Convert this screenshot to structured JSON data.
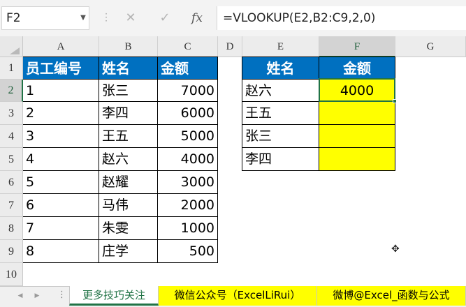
{
  "formula_bar": {
    "name_box": "F2",
    "cancel_icon": "✕",
    "enter_icon": "✓",
    "fx_label": "fx",
    "formula": "=VLOOKUP(E2,B2:C9,2,0)"
  },
  "columns": [
    "A",
    "B",
    "C",
    "D",
    "E",
    "F",
    "G"
  ],
  "rows": [
    "1",
    "2",
    "3",
    "4",
    "5",
    "6",
    "7",
    "8",
    "9",
    "10"
  ],
  "table1": {
    "headers": [
      "员工编号",
      "姓名",
      "金额"
    ],
    "rows": [
      [
        "1",
        "张三",
        "7000"
      ],
      [
        "2",
        "李四",
        "6000"
      ],
      [
        "3",
        "王五",
        "5000"
      ],
      [
        "4",
        "赵六",
        "4000"
      ],
      [
        "5",
        "赵耀",
        "3000"
      ],
      [
        "6",
        "马伟",
        "2000"
      ],
      [
        "7",
        "朱雯",
        "1000"
      ],
      [
        "8",
        "庄学",
        "500"
      ]
    ]
  },
  "table2": {
    "headers": [
      "姓名",
      "金额"
    ],
    "rows": [
      [
        "赵六",
        "4000"
      ],
      [
        "王五",
        ""
      ],
      [
        "张三",
        ""
      ],
      [
        "李四",
        ""
      ]
    ]
  },
  "sheet_tabs": [
    "更多技巧关注",
    "微信公众号（ExcelLiRui）",
    "微博@Excel_函数与公式"
  ],
  "colors": {
    "header_blue": "#0070c0",
    "highlight_yellow": "#ffff00",
    "excel_green": "#217346"
  }
}
